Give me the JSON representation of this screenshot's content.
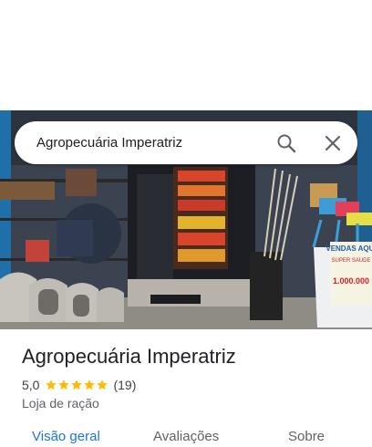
{
  "search": {
    "query": "Agropecuária Imperatriz"
  },
  "place": {
    "name": "Agropecuária Imperatriz",
    "rating": "5,0",
    "stars": 5,
    "reviews": "(19)",
    "category": "Loja de ração"
  },
  "photo_signs": {
    "sign_line1": "VENDAS AQUI",
    "sign_line2": "SUPER SAUDE",
    "sign_line3": "1.000.000"
  },
  "tabs": [
    {
      "label": "Visão geral",
      "active": true
    },
    {
      "label": "Avaliações",
      "active": false
    },
    {
      "label": "Sobre",
      "active": false
    }
  ],
  "colors": {
    "accent": "#1a73e8",
    "star": "#fbbc04",
    "text": "#202124"
  }
}
